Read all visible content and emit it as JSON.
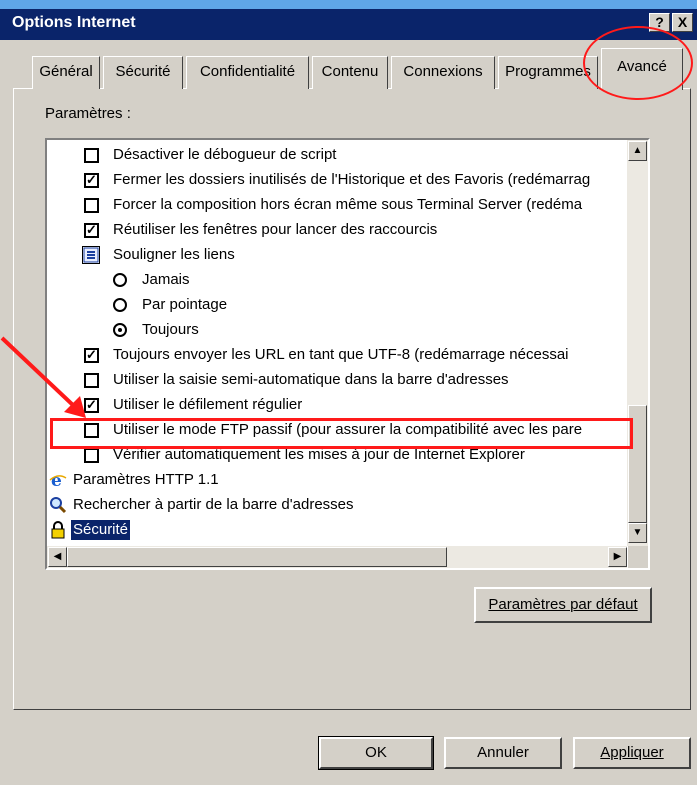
{
  "window": {
    "title": "Options Internet",
    "help_btn": "?",
    "close_btn": "X"
  },
  "tabs": [
    {
      "label": "Général"
    },
    {
      "label": "Sécurité"
    },
    {
      "label": "Confidentialité"
    },
    {
      "label": "Contenu"
    },
    {
      "label": "Connexions"
    },
    {
      "label": "Programmes"
    },
    {
      "label": "Avancé",
      "active": true
    }
  ],
  "panel": {
    "parameters_label": "Paramètres :"
  },
  "settings": [
    {
      "type": "checkbox",
      "checked": false,
      "label": "Désactiver le débogueur de script"
    },
    {
      "type": "checkbox",
      "checked": true,
      "label": "Fermer les dossiers inutilisés de l'Historique et des Favoris (redémarrag"
    },
    {
      "type": "checkbox",
      "checked": false,
      "label": "Forcer la composition hors écran même sous Terminal Server (redéma"
    },
    {
      "type": "checkbox",
      "checked": true,
      "label": "Réutiliser les fenêtres pour lancer des raccourcis"
    },
    {
      "type": "group",
      "icon": "list-icon",
      "label": "Souligner les liens"
    },
    {
      "type": "radio",
      "checked": false,
      "label": "Jamais"
    },
    {
      "type": "radio",
      "checked": false,
      "label": "Par pointage"
    },
    {
      "type": "radio",
      "checked": true,
      "label": "Toujours"
    },
    {
      "type": "checkbox",
      "checked": true,
      "label": "Toujours envoyer les URL en tant que UTF-8 (redémarrage nécessai"
    },
    {
      "type": "checkbox",
      "checked": false,
      "label": "Utiliser la saisie semi-automatique dans la barre d'adresses"
    },
    {
      "type": "checkbox",
      "checked": true,
      "label": "Utiliser le défilement régulier"
    },
    {
      "type": "checkbox",
      "checked": false,
      "label": "Utiliser le mode FTP passif (pour assurer la compatibilité avec les pare"
    },
    {
      "type": "checkbox",
      "checked": false,
      "label": "Vérifier automatiquement les mises à jour de Internet Explorer"
    },
    {
      "type": "category",
      "icon": "ie-icon",
      "label": "Paramètres HTTP 1.1"
    },
    {
      "type": "category",
      "icon": "magnifier-icon",
      "label": "Rechercher à partir de la barre d'adresses"
    },
    {
      "type": "category",
      "icon": "lock-icon",
      "label": "Sécurité",
      "selected": true
    }
  ],
  "buttons": {
    "defaults": "Paramètres par défaut",
    "ok": "OK",
    "cancel": "Annuler",
    "apply": "Appliquer"
  },
  "colors": {
    "titlebar": "#0a246a",
    "annotation": "#ff1a1a",
    "face": "#d4d0c8",
    "selection": "#0a246a"
  },
  "scroll": {
    "vertical_position": 0.78,
    "horizontal_position": 0.0
  }
}
